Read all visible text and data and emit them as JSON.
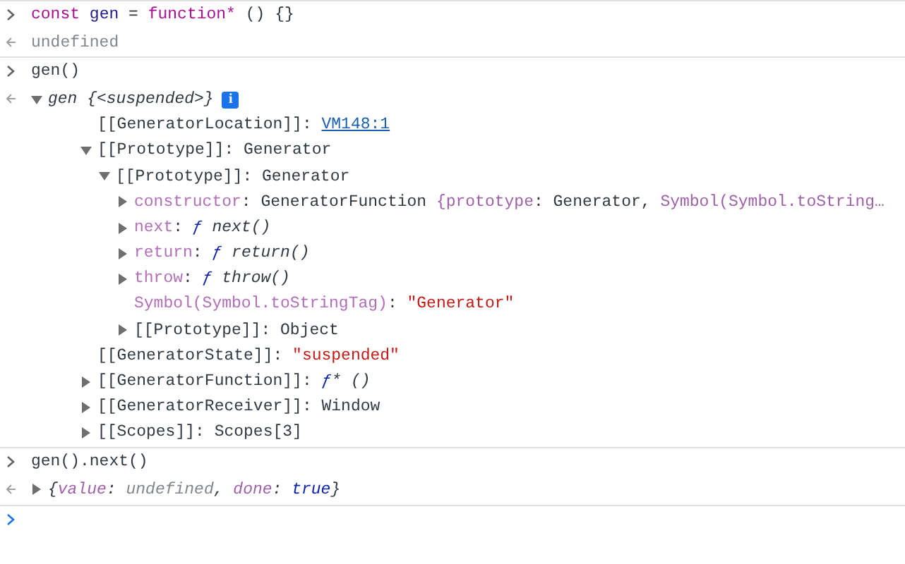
{
  "console": [
    {
      "kind": "input",
      "parts": [
        {
          "text": "const",
          "kind": "keyword"
        },
        {
          "text": " gen",
          "kind": "variable"
        },
        {
          "text": " = "
        },
        {
          "text": "function*",
          "kind": "keyword"
        },
        {
          "text": " () {}"
        }
      ]
    },
    {
      "kind": "result",
      "parts": [
        {
          "text": "undefined",
          "kind": "undefined"
        }
      ]
    },
    {
      "kind": "input",
      "parts": [
        {
          "text": "gen()"
        }
      ]
    },
    {
      "kind": "tree",
      "root": {
        "expanded": true,
        "italic": true,
        "info_badge": "i",
        "parts": [
          {
            "text": "gen {<suspended>}"
          }
        ],
        "children": [
          {
            "key": "[[GeneratorLocation]]",
            "kind": "internal",
            "parts": [
              {
                "text": ": "
              },
              {
                "text": "VM148:1",
                "kind": "link"
              }
            ]
          },
          {
            "key": "[[Prototype]]",
            "kind": "internal",
            "expanded": true,
            "parts": [
              {
                "text": ": Generator"
              }
            ],
            "children": [
              {
                "key": "[[Prototype]]",
                "kind": "internal",
                "expanded": true,
                "parts": [
                  {
                    "text": ": Generator"
                  }
                ],
                "children": [
                  {
                    "key": "constructor",
                    "kind": "nonenumerable",
                    "expanded": false,
                    "parts": [
                      {
                        "text": ": GeneratorFunction "
                      },
                      {
                        "text": "{prototype",
                        "kind": "dimtext"
                      },
                      {
                        "text": ": Generator, "
                      },
                      {
                        "text": "Symbol(Symbol.toString…",
                        "kind": "dimtext"
                      }
                    ]
                  },
                  {
                    "key": "next",
                    "kind": "nonenumerable",
                    "expanded": false,
                    "parts": [
                      {
                        "text": ": "
                      },
                      {
                        "text": "ƒ",
                        "kind": "func"
                      },
                      {
                        "text": " next()",
                        "kind": "italic"
                      }
                    ]
                  },
                  {
                    "key": "return",
                    "kind": "nonenumerable",
                    "expanded": false,
                    "parts": [
                      {
                        "text": ": "
                      },
                      {
                        "text": "ƒ",
                        "kind": "func"
                      },
                      {
                        "text": " return()",
                        "kind": "italic"
                      }
                    ]
                  },
                  {
                    "key": "throw",
                    "kind": "nonenumerable",
                    "expanded": false,
                    "parts": [
                      {
                        "text": ": "
                      },
                      {
                        "text": "ƒ",
                        "kind": "func"
                      },
                      {
                        "text": " throw()",
                        "kind": "italic"
                      }
                    ]
                  },
                  {
                    "key": "Symbol(Symbol.toStringTag)",
                    "kind": "nonenumerable",
                    "parts": [
                      {
                        "text": ": "
                      },
                      {
                        "text": "\"Generator\"",
                        "kind": "string"
                      }
                    ]
                  },
                  {
                    "key": "[[Prototype]]",
                    "kind": "internal",
                    "expanded": false,
                    "parts": [
                      {
                        "text": ": Object"
                      }
                    ]
                  }
                ]
              }
            ]
          },
          {
            "key": "[[GeneratorState]]",
            "kind": "internal",
            "parts": [
              {
                "text": ": "
              },
              {
                "text": "\"suspended\"",
                "kind": "string"
              }
            ]
          },
          {
            "key": "[[GeneratorFunction]]",
            "kind": "internal",
            "expanded": false,
            "parts": [
              {
                "text": ": "
              },
              {
                "text": "ƒ",
                "kind": "func"
              },
              {
                "text": "* ()",
                "kind": "italic"
              }
            ]
          },
          {
            "key": "[[GeneratorReceiver]]",
            "kind": "internal",
            "expanded": false,
            "parts": [
              {
                "text": ": Window"
              }
            ]
          },
          {
            "key": "[[Scopes]]",
            "kind": "internal",
            "expanded": false,
            "parts": [
              {
                "text": ": Scopes[3]"
              }
            ]
          }
        ]
      }
    },
    {
      "kind": "input",
      "parts": [
        {
          "text": "gen().next()"
        }
      ]
    },
    {
      "kind": "tree",
      "root": {
        "expanded": false,
        "italic": true,
        "parts": [
          {
            "text": "{"
          },
          {
            "text": "value",
            "kind": "dimtext"
          },
          {
            "text": ": "
          },
          {
            "text": "undefined",
            "kind": "undefined"
          },
          {
            "text": ", "
          },
          {
            "text": "done",
            "kind": "dimtext"
          },
          {
            "text": ": "
          },
          {
            "text": "true",
            "kind": "bool"
          },
          {
            "text": "}"
          }
        ]
      }
    },
    {
      "kind": "prompt"
    }
  ]
}
